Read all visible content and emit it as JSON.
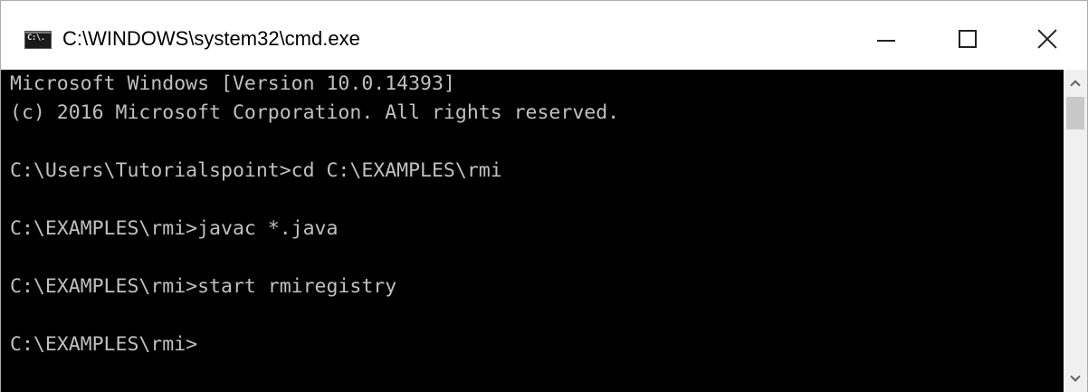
{
  "window": {
    "title": "C:\\WINDOWS\\system32\\cmd.exe",
    "icon": "cmd-icon",
    "icon_label": "C:\\."
  },
  "caption_buttons": {
    "minimize": "minimize-icon",
    "maximize": "maximize-icon",
    "close": "close-icon"
  },
  "console": {
    "foreground": "#c0c0c0",
    "background": "#000000",
    "lines": [
      "Microsoft Windows [Version 10.0.14393]",
      "(c) 2016 Microsoft Corporation. All rights reserved.",
      "C:\\Users\\Tutorialspoint>cd C:\\EXAMPLES\\rmi",
      "C:\\EXAMPLES\\rmi>javac *.java",
      "C:\\EXAMPLES\\rmi>start rmiregistry",
      "C:\\EXAMPLES\\rmi>"
    ]
  },
  "scrollbar": {
    "up_icon": "chevron-up-icon",
    "down_icon": "chevron-down-icon"
  }
}
